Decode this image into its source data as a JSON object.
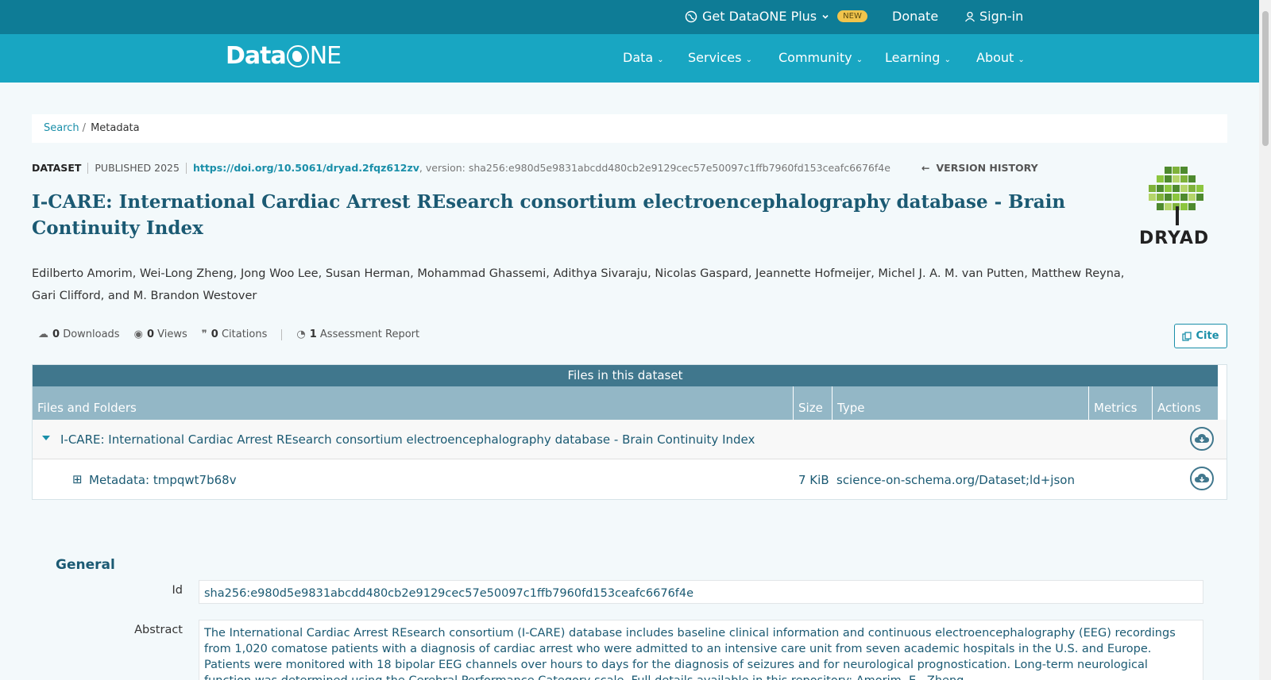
{
  "topbar": {
    "plus_label": "Get DataONE Plus",
    "new_badge": "NEW",
    "donate": "Donate",
    "signin": "Sign-in"
  },
  "logo": {
    "part1": "Data",
    "part2": "NE"
  },
  "nav": [
    "Data",
    "Services",
    "Community",
    "Learning",
    "About"
  ],
  "breadcrumb": {
    "search": "Search",
    "sep": "/",
    "current": "Metadata"
  },
  "meta": {
    "type": "DATASET",
    "published": "PUBLISHED 2025",
    "doi": "https://doi.org/10.5061/dryad.2fqz612zv",
    "version": ", version: sha256:e980d5e9831abcdd480cb2e9129cec57e50097c1ffb7960fd153ceafc6676f4e",
    "version_history": "VERSION HISTORY"
  },
  "title": "I-CARE: International Cardiac Arrest REsearch consortium electroencephalography database - Brain Continuity Index",
  "repository_logo": "DRYAD",
  "authors": "Edilberto Amorim, Wei-Long Zheng, Jong Woo Lee, Susan Herman, Mohammad Ghassemi, Adithya Sivaraju, Nicolas Gaspard, Jeannette Hofmeijer, Michel J. A. M. van Putten, Matthew Reyna, Gari Clifford, and M. Brandon Westover",
  "stats": {
    "downloads_count": "0",
    "downloads_label": "Downloads",
    "views_count": "0",
    "views_label": "Views",
    "citations_count": "0",
    "citations_label": "Citations",
    "assessment_count": "1",
    "assessment_label": "Assessment Report"
  },
  "cite_label": "Cite",
  "files": {
    "heading": "Files in this dataset",
    "columns": [
      "Files and Folders",
      "Size",
      "Type",
      "Metrics",
      "Actions"
    ],
    "folder": "I-CARE: International Cardiac Arrest REsearch consortium electroencephalography database - Brain Continuity Index",
    "file_name": "Metadata: tmpqwt7b68v",
    "file_size": "7 KiB",
    "file_type": "science-on-schema.org/Dataset;ld+json"
  },
  "general": {
    "heading": "General",
    "id_label": "Id",
    "id_value": "sha256:e980d5e9831abcdd480cb2e9129cec57e50097c1ffb7960fd153ceafc6676f4e",
    "abstract_label": "Abstract",
    "abstract_value": "The International Cardiac Arrest REsearch consortium (I-CARE) database includes baseline clinical information and continuous electroencephalography (EEG) recordings from 1,020 comatose patients with a diagnosis of cardiac arrest who were admitted to an intensive care unit from seven academic hospitals in the U.S. and Europe. Patients were monitored with 18 bipolar EEG channels over hours to days for the diagnosis of seizures and for neurological prognostication. Long-term neurological function was determined using the Cerebral Performance Category scale. Full details available in this repository: Amorim, E., Zheng,"
  },
  "colors": {
    "topbar": "#0e7c96",
    "navbar": "#18a6c2",
    "accent": "#1a8fa9",
    "title": "#1b5a73",
    "table_header": "#40778d"
  }
}
